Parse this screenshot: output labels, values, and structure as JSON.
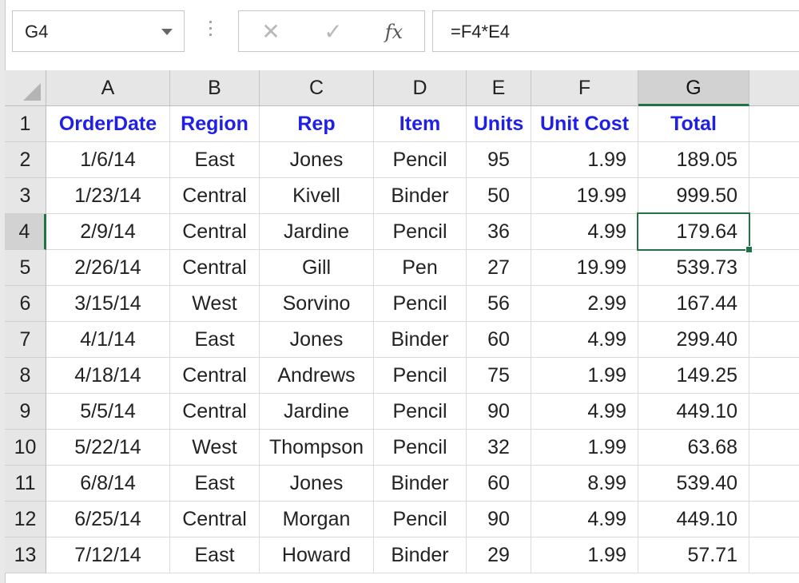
{
  "name_box": {
    "value": "G4"
  },
  "formula_bar": {
    "value": "=F4*E4",
    "cancel_icon": "x-icon",
    "enter_icon": "check-icon",
    "function_icon": "fx-icon",
    "fx_label": "fx"
  },
  "columns": [
    "A",
    "B",
    "C",
    "D",
    "E",
    "F",
    "G"
  ],
  "active_cell": {
    "column": "G",
    "row": "4"
  },
  "header_row": {
    "row": "1",
    "cells": [
      "OrderDate",
      "Region",
      "Rep",
      "Item",
      "Units",
      "Unit Cost",
      "Total"
    ]
  },
  "rows": [
    {
      "row": "2",
      "cells": [
        "1/6/14",
        "East",
        "Jones",
        "Pencil",
        "95",
        "1.99",
        "189.05"
      ]
    },
    {
      "row": "3",
      "cells": [
        "1/23/14",
        "Central",
        "Kivell",
        "Binder",
        "50",
        "19.99",
        "999.50"
      ]
    },
    {
      "row": "4",
      "cells": [
        "2/9/14",
        "Central",
        "Jardine",
        "Pencil",
        "36",
        "4.99",
        "179.64"
      ]
    },
    {
      "row": "5",
      "cells": [
        "2/26/14",
        "Central",
        "Gill",
        "Pen",
        "27",
        "19.99",
        "539.73"
      ]
    },
    {
      "row": "6",
      "cells": [
        "3/15/14",
        "West",
        "Sorvino",
        "Pencil",
        "56",
        "2.99",
        "167.44"
      ]
    },
    {
      "row": "7",
      "cells": [
        "4/1/14",
        "East",
        "Jones",
        "Binder",
        "60",
        "4.99",
        "299.40"
      ]
    },
    {
      "row": "8",
      "cells": [
        "4/18/14",
        "Central",
        "Andrews",
        "Pencil",
        "75",
        "1.99",
        "149.25"
      ]
    },
    {
      "row": "9",
      "cells": [
        "5/5/14",
        "Central",
        "Jardine",
        "Pencil",
        "90",
        "4.99",
        "449.10"
      ]
    },
    {
      "row": "10",
      "cells": [
        "5/22/14",
        "West",
        "Thompson",
        "Pencil",
        "32",
        "1.99",
        "63.68"
      ]
    },
    {
      "row": "11",
      "cells": [
        "6/8/14",
        "East",
        "Jones",
        "Binder",
        "60",
        "8.99",
        "539.40"
      ]
    },
    {
      "row": "12",
      "cells": [
        "6/25/14",
        "Central",
        "Morgan",
        "Pencil",
        "90",
        "4.99",
        "449.10"
      ]
    },
    {
      "row": "13",
      "cells": [
        "7/12/14",
        "East",
        "Howard",
        "Binder",
        "29",
        "1.99",
        "57.71"
      ]
    }
  ],
  "colors": {
    "header_text": "#1f1fe6",
    "selection": "#217346"
  }
}
